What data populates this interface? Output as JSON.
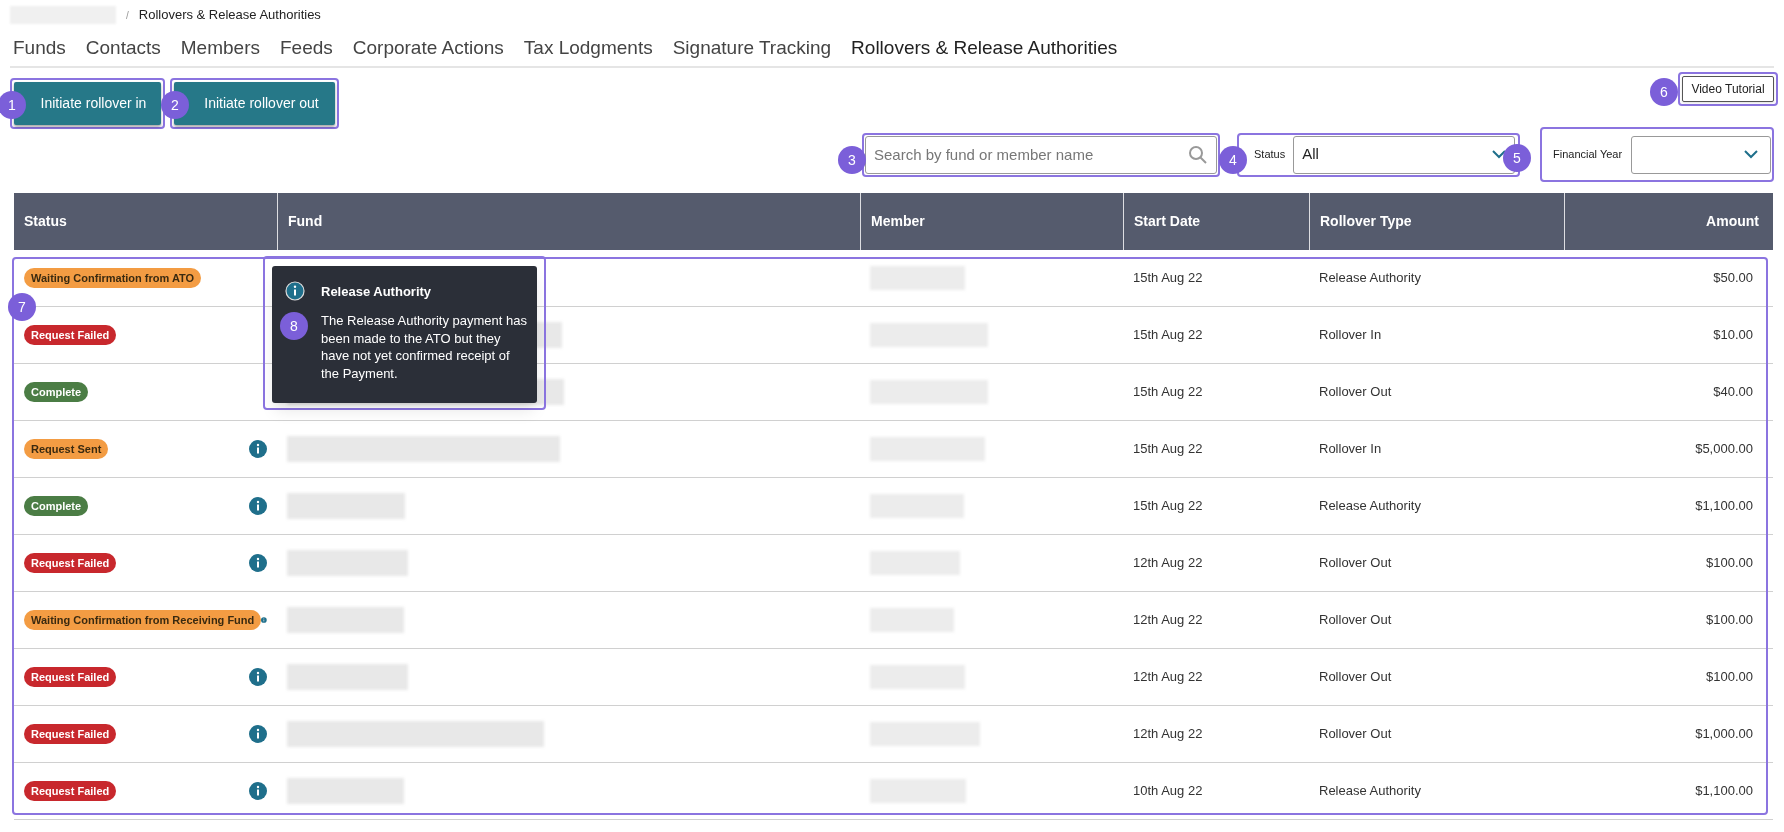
{
  "breadcrumb": {
    "separator": "/",
    "current": "Rollovers & Release Authorities"
  },
  "nav": [
    {
      "label": "Funds",
      "selected": false
    },
    {
      "label": "Contacts",
      "selected": false
    },
    {
      "label": "Members",
      "selected": false
    },
    {
      "label": "Feeds",
      "selected": false
    },
    {
      "label": "Corporate Actions",
      "selected": false
    },
    {
      "label": "Tax Lodgments",
      "selected": false
    },
    {
      "label": "Signature Tracking",
      "selected": false
    },
    {
      "label": "Rollovers & Release Authorities",
      "selected": true
    }
  ],
  "actions": [
    "Initiate rollover in",
    "Initiate rollover out"
  ],
  "video_button": "Video Tutorial",
  "filters": {
    "search": {
      "placeholder": "Search by fund or member name"
    },
    "status": {
      "label": "Status",
      "value": "All"
    },
    "financial_year": {
      "label": "Financial Year"
    }
  },
  "table": {
    "columns": [
      "Status",
      "Fund",
      "Member",
      "Start Date",
      "Rollover Type",
      "Amount"
    ],
    "rows": [
      {
        "status": "Waiting Confirmation from ATO",
        "color": "#f39c43",
        "info_icon": false,
        "start_date": "15th Aug 22",
        "rollover_type": "Release Authority",
        "amount": "$50.00"
      },
      {
        "status": "Request Failed",
        "color": "#c8282d",
        "info_icon": false,
        "start_date": "15th Aug 22",
        "rollover_type": "Rollover In",
        "amount": "$10.00"
      },
      {
        "status": "Complete",
        "color": "#4b7d45",
        "info_icon": false,
        "start_date": "15th Aug 22",
        "rollover_type": "Rollover Out",
        "amount": "$40.00"
      },
      {
        "status": "Request Sent",
        "color": "#f39c43",
        "info_icon": true,
        "start_date": "15th Aug 22",
        "rollover_type": "Rollover In",
        "amount": "$5,000.00"
      },
      {
        "status": "Complete",
        "color": "#4b7d45",
        "info_icon": true,
        "start_date": "15th Aug 22",
        "rollover_type": "Release Authority",
        "amount": "$1,100.00"
      },
      {
        "status": "Request Failed",
        "color": "#c8282d",
        "info_icon": true,
        "start_date": "12th Aug 22",
        "rollover_type": "Rollover Out",
        "amount": "$100.00"
      },
      {
        "status": "Waiting Confirmation from Receiving Fund",
        "color": "#f39c43",
        "info_icon": true,
        "start_date": "12th Aug 22",
        "rollover_type": "Rollover Out",
        "amount": "$100.00"
      },
      {
        "status": "Request Failed",
        "color": "#c8282d",
        "info_icon": true,
        "start_date": "12th Aug 22",
        "rollover_type": "Rollover Out",
        "amount": "$100.00"
      },
      {
        "status": "Request Failed",
        "color": "#c8282d",
        "info_icon": true,
        "start_date": "12th Aug 22",
        "rollover_type": "Rollover Out",
        "amount": "$1,000.00"
      },
      {
        "status": "Request Failed",
        "color": "#c8282d",
        "info_icon": true,
        "start_date": "10th Aug 22",
        "rollover_type": "Release Authority",
        "amount": "$1,100.00"
      }
    ]
  },
  "tooltip": {
    "title": "Release Authority",
    "text": "The Release Authority payment has been made to the ATO but they have not yet confirmed receipt of the Payment."
  },
  "callouts": [
    "1",
    "2",
    "3",
    "4",
    "5",
    "6",
    "7",
    "8"
  ]
}
